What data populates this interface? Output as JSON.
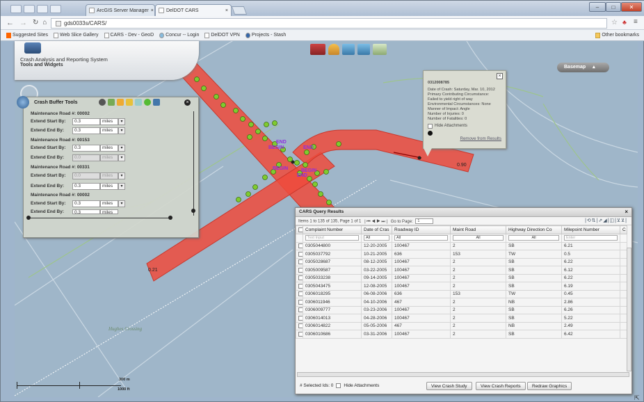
{
  "browser": {
    "tabs": [
      {
        "label": "ArcGIS Server Manager",
        "active": false
      },
      {
        "label": "DelDOT CARS",
        "active": true
      }
    ],
    "url": "gds0033s/CARS/",
    "bookmarks": [
      "Suggested Sites",
      "Web Slice Gallery",
      "CARS - Dev - GeoD",
      "Concur -- Login",
      "DelDOT VPN",
      "Projects - Stash"
    ],
    "other_bookmarks": "Other bookmarks"
  },
  "app": {
    "title": "Crash Analysis and Reporting System",
    "subtitle": "Tools and Widgets",
    "basemap_label": "Basemap"
  },
  "map": {
    "labels": {
      "begin1": "BEGIN",
      "end1": "END",
      "begin2": "BEGIN",
      "end2": "END",
      "begin3": "BEGIN",
      "end3": "END",
      "begin4": "BEGIN",
      "end4": "END",
      "mile1": "0.90",
      "mile2": "0.21",
      "place": "Hughes Crossing"
    },
    "scalebar": {
      "meters": "300 m",
      "feet": "1000 ft"
    }
  },
  "buffer_tools": {
    "title": "Crash Buffer Tools",
    "roads": [
      {
        "name": "Maintenance Road #: 00002",
        "start": "0.3",
        "end": "0.3",
        "unit": "miles",
        "end_disabled": false
      },
      {
        "name": "Maintenance Road #: 00153",
        "start": "0.3",
        "end": "0.0",
        "unit": "miles",
        "end_disabled": true
      },
      {
        "name": "Maintenance Road #: 00331",
        "start": "0.0",
        "end": "0.3",
        "unit": "miles",
        "start_disabled": true
      },
      {
        "name": "Maintenance Road #: 00002",
        "start": "0.3",
        "end": "0.3",
        "unit": "miles"
      }
    ],
    "start_label": "Extend Start By:",
    "end_label": "Extend End By:"
  },
  "popup": {
    "id": "0312008785",
    "lines": [
      "Date of Crash: Saturday, Mar. 10, 2012",
      "Primary Contributing Circumstance:",
      "Failed to yield right of way",
      "Environmental Circumstances: None",
      "Manner of Impact: Angle",
      "Number of Injuries: 0",
      "Number of Fatalities: 0"
    ],
    "hide_attachments": "Hide Attachments",
    "remove_link": "Remove from Results"
  },
  "results": {
    "title": "CARS Query Results",
    "pager": "Items 1 to 135 of 135, Page 1 of 1",
    "goto": "Go to Page:",
    "page_value": "1",
    "columns": [
      "Complaint Number",
      "Date of Cras",
      "Roadway ID",
      "Maint Road",
      "Highway Direction Co",
      "Milepoint Number",
      "C"
    ],
    "filters": [
      "Text Input",
      "All",
      "All",
      "All",
      "All",
      "Enter"
    ],
    "rows": [
      [
        "0305044800",
        "12-20-2005",
        "100467",
        "2",
        "SB",
        "6.21"
      ],
      [
        "0305037792",
        "10-21-2005",
        "636",
        "153",
        "TW",
        "0.5"
      ],
      [
        "0305028687",
        "08-12-2005",
        "100467",
        "2",
        "SB",
        "6.22"
      ],
      [
        "0305009587",
        "03-22-2005",
        "100467",
        "2",
        "SB",
        "6.12"
      ],
      [
        "0305033238",
        "09-14-2005",
        "100467",
        "2",
        "SB",
        "6.22"
      ],
      [
        "0305043475",
        "12-08-2005",
        "100467",
        "2",
        "SB",
        "6.19"
      ],
      [
        "0306018295",
        "06-08-2006",
        "636",
        "153",
        "TW",
        "0.45"
      ],
      [
        "0306011946",
        "04-10-2006",
        "467",
        "2",
        "NB",
        "2.86"
      ],
      [
        "0306009777",
        "03-23-2006",
        "100467",
        "2",
        "SB",
        "6.26"
      ],
      [
        "0306014013",
        "04-28-2006",
        "100467",
        "2",
        "SB",
        "5.22"
      ],
      [
        "0306014822",
        "05-05-2006",
        "467",
        "2",
        "NB",
        "2.49"
      ],
      [
        "0306010686",
        "03-31-2006",
        "100467",
        "2",
        "SB",
        "6.42"
      ]
    ],
    "selected_ids": "# Selected Ids: 0",
    "hide_attachments": "Hide Attachments",
    "buttons": [
      "View Crash Study",
      "View Crash Reports",
      "Redraw Graphics"
    ]
  },
  "colors": {
    "road_buffer": "#ef4b3c",
    "marker": "#7fcb2f",
    "label": "#8e2de0"
  }
}
